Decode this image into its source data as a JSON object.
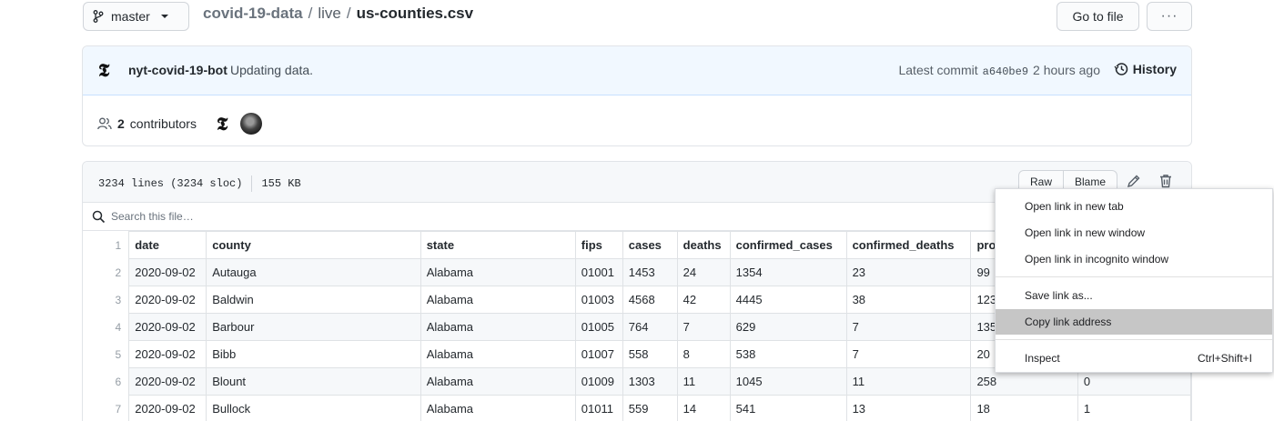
{
  "topbar": {
    "branch": "master",
    "breadcrumb": {
      "repo": "covid-19-data",
      "folder": "live",
      "file": "us-counties.csv"
    },
    "goto_file": "Go to file",
    "more": "···"
  },
  "commit": {
    "author": "nyt-covid-19-bot",
    "message": "Updating data.",
    "latest_label": "Latest commit",
    "sha": "a640be9",
    "time": "2 hours ago",
    "history_label": "History",
    "contributors_count": "2",
    "contributors_label": "contributors"
  },
  "file": {
    "lines": "3234 lines (3234 sloc)",
    "size": "155 KB",
    "raw": "Raw",
    "blame": "Blame",
    "search_placeholder": "Search this file…",
    "columns": [
      "date",
      "county",
      "state",
      "fips",
      "cases",
      "deaths",
      "confirmed_cases",
      "confirmed_deaths",
      "prob",
      ""
    ],
    "rows": [
      [
        "2020-09-02",
        "Autauga",
        "Alabama",
        "01001",
        "1453",
        "24",
        "1354",
        "23",
        "99",
        ""
      ],
      [
        "2020-09-02",
        "Baldwin",
        "Alabama",
        "01003",
        "4568",
        "42",
        "4445",
        "38",
        "123",
        ""
      ],
      [
        "2020-09-02",
        "Barbour",
        "Alabama",
        "01005",
        "764",
        "7",
        "629",
        "7",
        "135",
        ""
      ],
      [
        "2020-09-02",
        "Bibb",
        "Alabama",
        "01007",
        "558",
        "8",
        "538",
        "7",
        "20",
        ""
      ],
      [
        "2020-09-02",
        "Blount",
        "Alabama",
        "01009",
        "1303",
        "11",
        "1045",
        "11",
        "258",
        "0"
      ],
      [
        "2020-09-02",
        "Bullock",
        "Alabama",
        "01011",
        "559",
        "14",
        "541",
        "13",
        "18",
        "1"
      ]
    ]
  },
  "context_menu": {
    "items": [
      {
        "label": "Open link in new tab",
        "shortcut": ""
      },
      {
        "label": "Open link in new window",
        "shortcut": ""
      },
      {
        "label": "Open link in incognito window",
        "shortcut": ""
      },
      {
        "label": "Save link as...",
        "shortcut": ""
      },
      {
        "label": "Copy link address",
        "shortcut": "",
        "highlighted": true
      },
      {
        "label": "Inspect",
        "shortcut": "Ctrl+Shift+I"
      }
    ]
  }
}
